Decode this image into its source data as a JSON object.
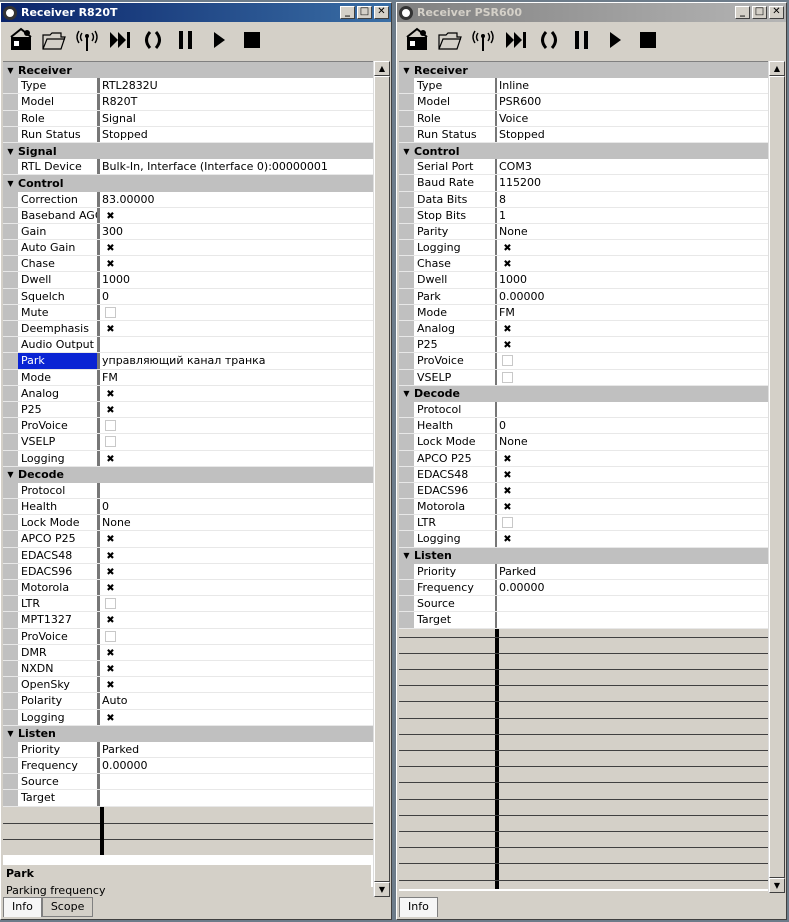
{
  "windows": [
    {
      "title": "Receiver R820T",
      "categories": [
        {
          "name": "Receiver",
          "rows": [
            {
              "name": "Type",
              "value": "RTL2832U"
            },
            {
              "name": "Model",
              "value": "R820T"
            },
            {
              "name": "Role",
              "value": "Signal"
            },
            {
              "name": "Run Status",
              "value": "Stopped"
            }
          ]
        },
        {
          "name": "Signal",
          "rows": [
            {
              "name": "RTL Device",
              "value": "Bulk-In, Interface (Interface 0):00000001"
            }
          ]
        },
        {
          "name": "Control",
          "rows": [
            {
              "name": "Correction",
              "value": "83.00000"
            },
            {
              "name": "Baseband AGC",
              "check": true
            },
            {
              "name": "Gain",
              "value": "300"
            },
            {
              "name": "Auto Gain",
              "check": true
            },
            {
              "name": "Chase",
              "check": true
            },
            {
              "name": "Dwell",
              "value": "1000"
            },
            {
              "name": "Squelch",
              "value": "0"
            },
            {
              "name": "Mute",
              "check": false
            },
            {
              "name": "Deemphasis",
              "check": true
            },
            {
              "name": "Audio Output",
              "value": ""
            },
            {
              "name": "Park",
              "value": "управляющий канал транка",
              "selected": true
            },
            {
              "name": "Mode",
              "value": "FM"
            },
            {
              "name": "Analog",
              "check": true
            },
            {
              "name": "P25",
              "check": true
            },
            {
              "name": "ProVoice",
              "check": false
            },
            {
              "name": "VSELP",
              "check": false
            },
            {
              "name": "Logging",
              "check": true
            }
          ]
        },
        {
          "name": "Decode",
          "rows": [
            {
              "name": "Protocol",
              "value": ""
            },
            {
              "name": "Health",
              "value": "0"
            },
            {
              "name": "Lock Mode",
              "value": "None"
            },
            {
              "name": "APCO P25",
              "check": true
            },
            {
              "name": "EDACS48",
              "check": true
            },
            {
              "name": "EDACS96",
              "check": true
            },
            {
              "name": "Motorola",
              "check": true
            },
            {
              "name": "LTR",
              "check": false
            },
            {
              "name": "MPT1327",
              "check": true
            },
            {
              "name": "ProVoice",
              "check": false
            },
            {
              "name": "DMR",
              "check": true
            },
            {
              "name": "NXDN",
              "check": true
            },
            {
              "name": "OpenSky",
              "check": true
            },
            {
              "name": "Polarity",
              "value": "Auto"
            },
            {
              "name": "Logging",
              "check": true
            }
          ]
        },
        {
          "name": "Listen",
          "rows": [
            {
              "name": "Priority",
              "value": "Parked"
            },
            {
              "name": "Frequency",
              "value": "0.00000"
            },
            {
              "name": "Source",
              "value": ""
            },
            {
              "name": "Target",
              "value": ""
            }
          ]
        }
      ],
      "description": {
        "title": "Park",
        "text": "Parking frequency"
      },
      "tabs": [
        "Info",
        "Scope"
      ]
    },
    {
      "title": "Receiver PSR600",
      "categories": [
        {
          "name": "Receiver",
          "rows": [
            {
              "name": "Type",
              "value": "Inline"
            },
            {
              "name": "Model",
              "value": "PSR600"
            },
            {
              "name": "Role",
              "value": "Voice"
            },
            {
              "name": "Run Status",
              "value": "Stopped"
            }
          ]
        },
        {
          "name": "Control",
          "rows": [
            {
              "name": "Serial Port",
              "value": "COM3"
            },
            {
              "name": "Baud Rate",
              "value": "115200"
            },
            {
              "name": "Data Bits",
              "value": "8"
            },
            {
              "name": "Stop Bits",
              "value": "1"
            },
            {
              "name": "Parity",
              "value": "None"
            },
            {
              "name": "Logging",
              "check": true
            },
            {
              "name": "Chase",
              "check": true
            },
            {
              "name": "Dwell",
              "value": "1000"
            },
            {
              "name": "Park",
              "value": "0.00000"
            },
            {
              "name": "Mode",
              "value": "FM"
            },
            {
              "name": "Analog",
              "check": true
            },
            {
              "name": "P25",
              "check": true
            },
            {
              "name": "ProVoice",
              "check": false
            },
            {
              "name": "VSELP",
              "check": false
            }
          ]
        },
        {
          "name": "Decode",
          "rows": [
            {
              "name": "Protocol",
              "value": ""
            },
            {
              "name": "Health",
              "value": "0"
            },
            {
              "name": "Lock Mode",
              "value": "None"
            },
            {
              "name": "APCO P25",
              "check": true
            },
            {
              "name": "EDACS48",
              "check": true
            },
            {
              "name": "EDACS96",
              "check": true
            },
            {
              "name": "Motorola",
              "check": true
            },
            {
              "name": "LTR",
              "check": false
            },
            {
              "name": "Logging",
              "check": true
            }
          ]
        },
        {
          "name": "Listen",
          "rows": [
            {
              "name": "Priority",
              "value": "Parked"
            },
            {
              "name": "Frequency",
              "value": "0.00000"
            },
            {
              "name": "Source",
              "value": ""
            },
            {
              "name": "Target",
              "value": ""
            }
          ]
        }
      ],
      "tabs": [
        "Info"
      ]
    }
  ],
  "window_buttons": [
    "_",
    "□",
    "✕"
  ],
  "check_mark": "✖",
  "icons": [
    "home-radio-icon",
    "open-folder-icon",
    "antenna-icon",
    "skip-forward-icon",
    "loop-icon",
    "pause-icon",
    "play-icon",
    "stop-icon"
  ]
}
